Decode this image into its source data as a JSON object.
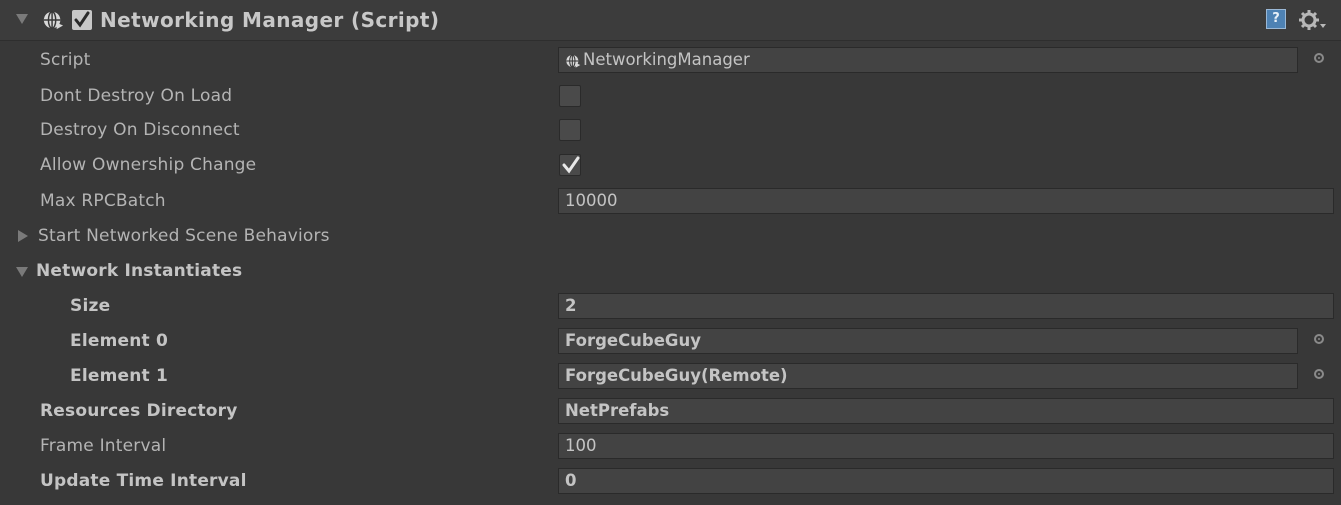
{
  "header": {
    "title": "Networking Manager (Script)",
    "enabled": true,
    "help_glyph": "?"
  },
  "rows": {
    "script": {
      "label": "Script",
      "value": "NetworkingManager",
      "icon": "globe-icon"
    },
    "dont_destroy_on_load": {
      "label": "Dont Destroy On Load",
      "checked": false
    },
    "destroy_on_disconnect": {
      "label": "Destroy On Disconnect",
      "checked": false
    },
    "allow_ownership_change": {
      "label": "Allow Ownership Change",
      "checked": true
    },
    "max_rpc_batch": {
      "label": "Max RPCBatch",
      "value": "10000"
    },
    "start_networked_scene_behaviors": {
      "label": "Start Networked Scene Behaviors",
      "expanded": false
    },
    "network_instantiates": {
      "label": "Network Instantiates",
      "expanded": true,
      "size_label": "Size",
      "size_value": "2",
      "elements": [
        {
          "label": "Element 0",
          "value": "ForgeCubeGuy"
        },
        {
          "label": "Element 1",
          "value": "ForgeCubeGuy(Remote)"
        }
      ]
    },
    "resources_directory": {
      "label": "Resources Directory",
      "value": "NetPrefabs"
    },
    "frame_interval": {
      "label": "Frame Interval",
      "value": "100"
    },
    "update_time_interval": {
      "label": "Update Time Interval",
      "value": "0"
    }
  },
  "colors": {
    "background": "#383838",
    "field": "#434343",
    "text": "#b4b4b4",
    "help_blue": "#4e82b4"
  }
}
